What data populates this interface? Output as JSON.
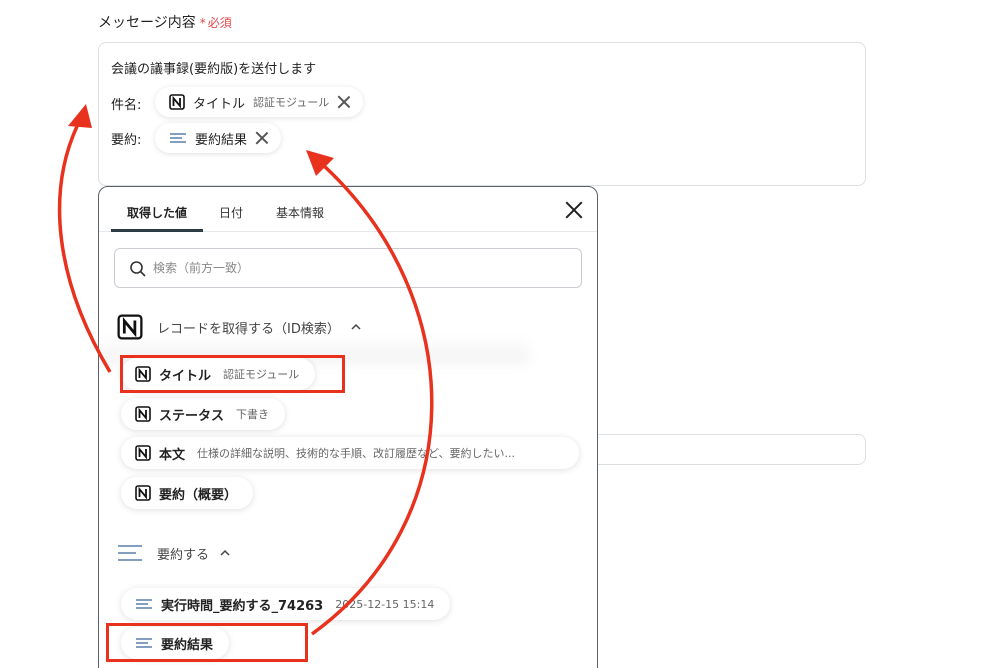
{
  "field": {
    "label": "メッセージ内容",
    "required_mark": "*",
    "required_text": "必須"
  },
  "message": {
    "line1": "会議の議事録(要約版)を送付します",
    "subject_label": "件名:",
    "summary_label": "要約:",
    "subject_chip": {
      "main": "タイトル",
      "sub": "認証モジュール",
      "icon": "notion-icon"
    },
    "summary_chip": {
      "main": "要約結果",
      "icon": "text-lines-icon"
    }
  },
  "panel": {
    "tabs": [
      {
        "label": "取得した値",
        "active": true
      },
      {
        "label": "日付",
        "active": false
      },
      {
        "label": "基本情報",
        "active": false
      }
    ],
    "search_placeholder": "検索（前方一致）",
    "groups": [
      {
        "label": "レコードを取得する（ID検索）",
        "icon": "notion-icon",
        "items": [
          {
            "main": "タイトル",
            "sub": "認証モジュール",
            "highlighted": true
          },
          {
            "main": "ステータス",
            "sub": "下書き"
          },
          {
            "main": "本文",
            "sub": "仕様の詳細な説明、技術的な手順、改訂履歴など、要約したい..."
          },
          {
            "main": "要約（概要）",
            "sub": ""
          }
        ]
      },
      {
        "label": "要約する",
        "icon": "text-lines-icon",
        "items": [
          {
            "main": "実行時間_要約する_74263",
            "sub": "2025-12-15 15:14"
          },
          {
            "main": "要約結果",
            "sub": "",
            "highlighted": true
          }
        ]
      }
    ]
  },
  "colors": {
    "accent_red": "#e8321e",
    "required_red": "#e5484d",
    "tab_underline": "#2d3b45",
    "lines_icon": "#5a7fa8"
  }
}
